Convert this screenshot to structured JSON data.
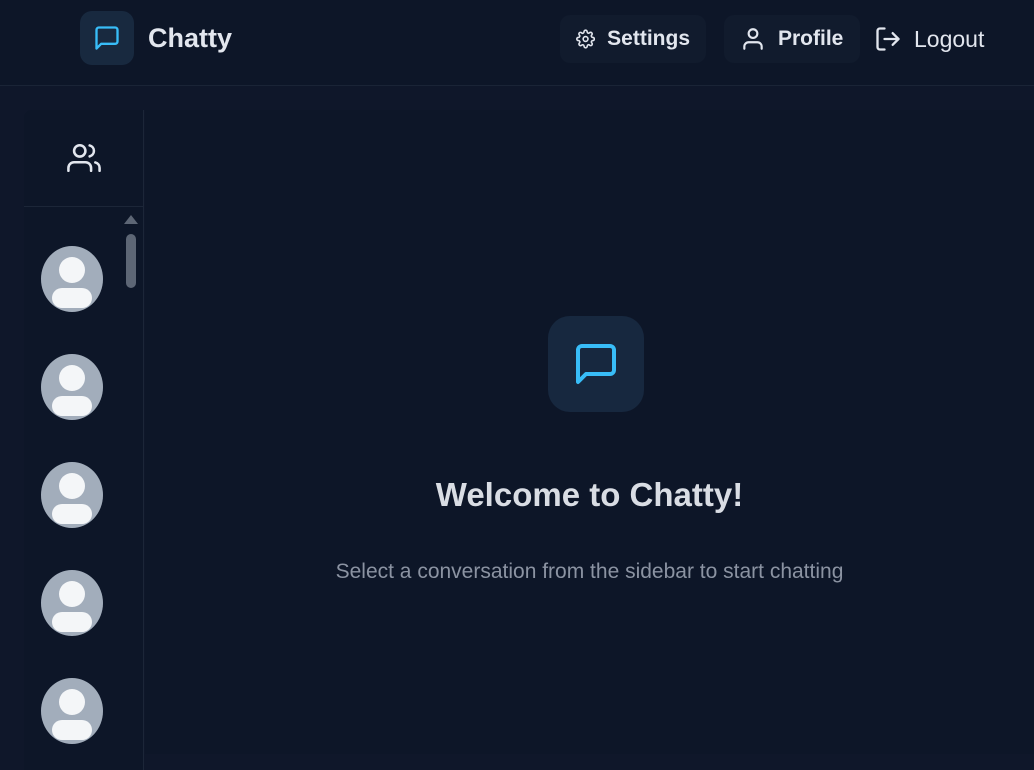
{
  "navbar": {
    "brand_name": "Chatty",
    "brand_icon": "message-square-icon",
    "settings_label": "Settings",
    "settings_icon": "gear-icon",
    "profile_label": "Profile",
    "profile_icon": "user-icon",
    "logout_label": "Logout",
    "logout_icon": "logout-icon"
  },
  "sidebar": {
    "header_icon": "users-icon",
    "contacts": [
      {
        "avatar": "default-avatar"
      },
      {
        "avatar": "default-avatar"
      },
      {
        "avatar": "default-avatar"
      },
      {
        "avatar": "default-avatar"
      },
      {
        "avatar": "default-avatar"
      }
    ]
  },
  "welcome": {
    "icon": "message-square-icon",
    "title": "Welcome to Chatty!",
    "subtitle": "Select a conversation from the sidebar to start chatting"
  },
  "colors": {
    "accent": "#38bdf8",
    "background": "#0f172a",
    "surface": "#0d1628"
  }
}
